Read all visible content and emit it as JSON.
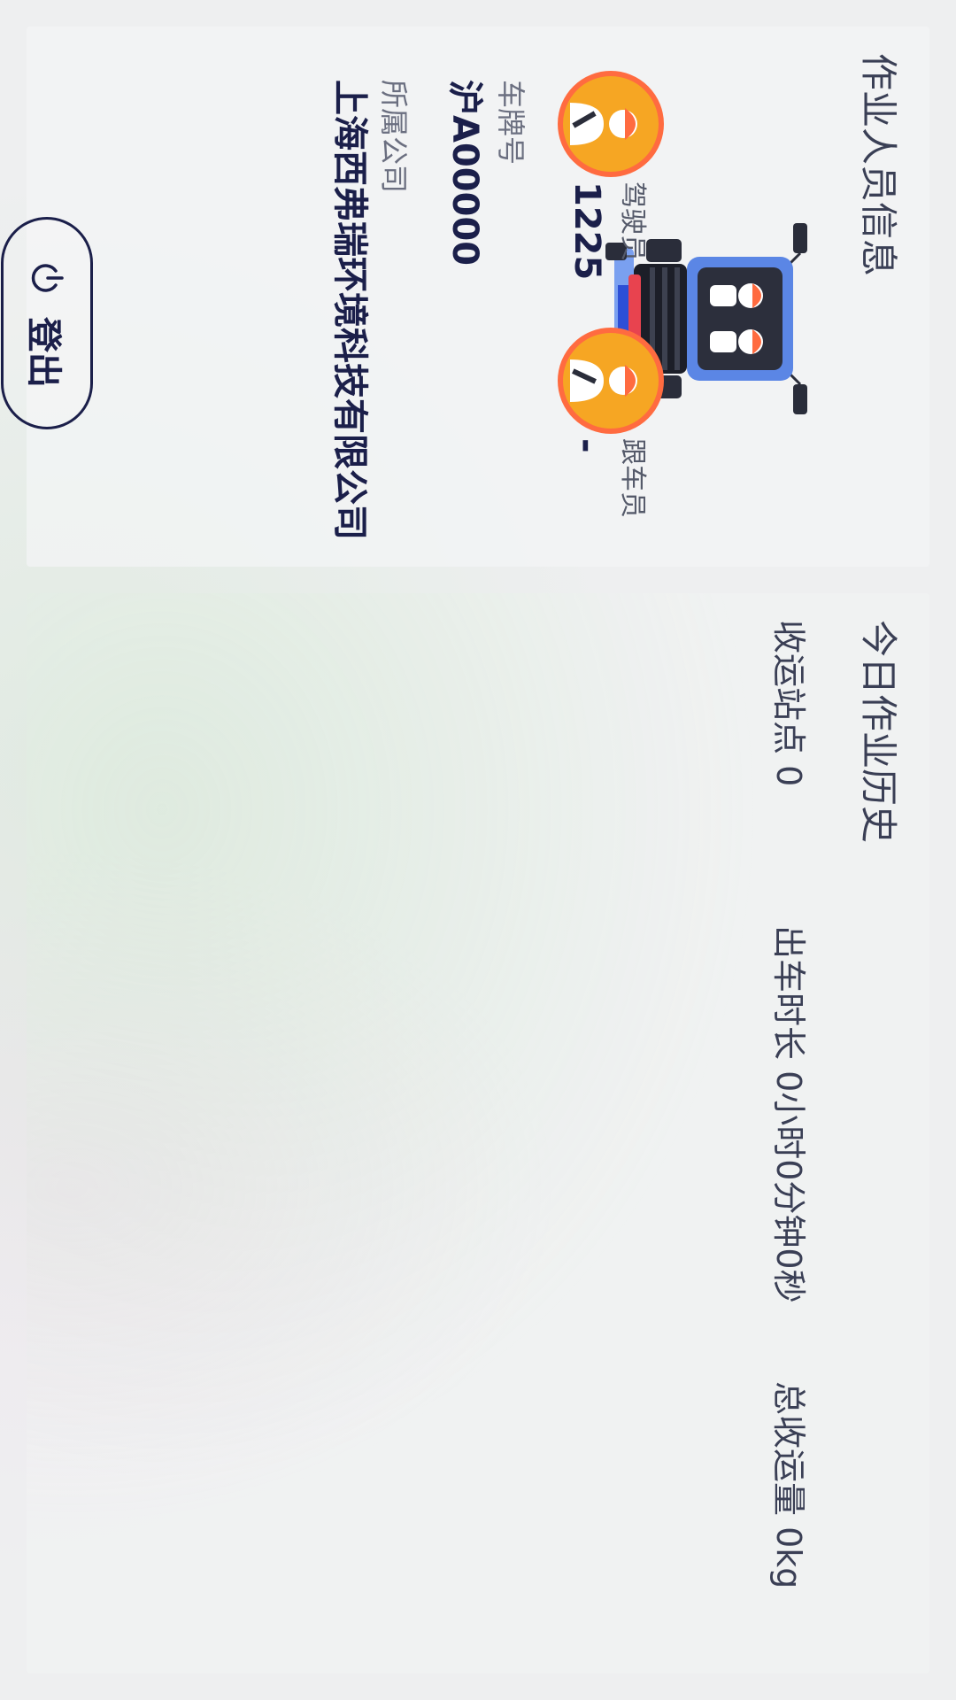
{
  "operator_info": {
    "title": "作业人员信息",
    "driver_label": "驾驶员",
    "driver_value": "1225",
    "escort_label": "跟车员",
    "escort_value": "-",
    "plate_label": "车牌号",
    "plate_value": "沪A00000",
    "company_label": "所属公司",
    "company_value": "上海西弗瑞环境科技有限公司",
    "logout_label": "登出"
  },
  "history": {
    "title": "今日作业历史",
    "stations": "收运站点 0",
    "duration": "出车时长 0小时0分钟0秒",
    "total": "总收运量 0kg"
  },
  "icons": {
    "truck": "garbage-truck-icon",
    "driver_avatar": "driver-avatar-icon",
    "escort_avatar": "escort-avatar-icon",
    "logout": "power-icon"
  },
  "colors": {
    "title_text": "#3a3f55",
    "value_text": "#1b1f4a",
    "avatar_orange": "#f6a623",
    "avatar_ring": "#ff6b40",
    "truck_blue": "#5b86e5"
  }
}
